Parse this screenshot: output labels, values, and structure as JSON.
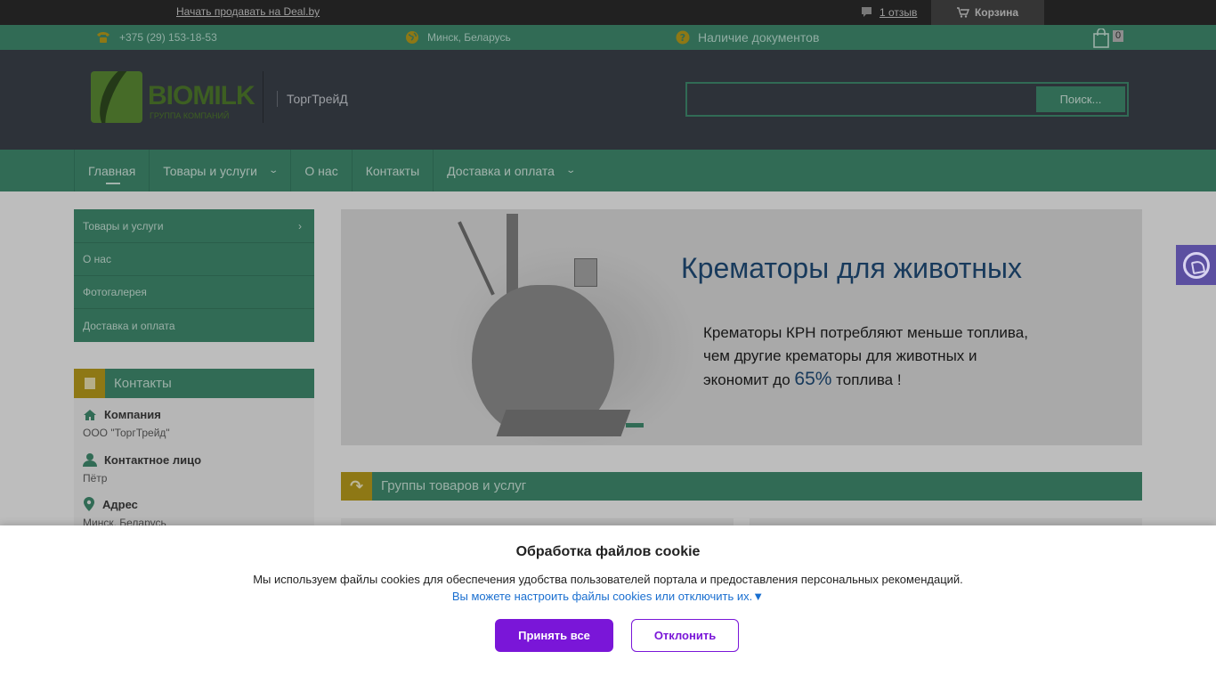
{
  "topbar": {
    "sell_link": "Начать продавать на Deal.by",
    "reviews_link": "1 отзыв",
    "cart_label": "Корзина"
  },
  "infobar": {
    "phone": "+375 (29) 153-18-53",
    "location": "Минск, Беларусь",
    "documents": "Наличие документов",
    "cart_count": "0"
  },
  "header": {
    "logo_text": "BIOMILK",
    "logo_sub": "ГРУППА КОМПАНИЙ",
    "company": "ТоргТрейД",
    "search_placeholder": "",
    "search_button": "Поиск..."
  },
  "nav": {
    "items": [
      {
        "label": "Главная"
      },
      {
        "label": "Товары и услуги"
      },
      {
        "label": "О нас"
      },
      {
        "label": "Контакты"
      },
      {
        "label": "Доставка и оплата"
      }
    ]
  },
  "sidebar": {
    "items": [
      {
        "label": "Товары и услуги"
      },
      {
        "label": "О нас"
      },
      {
        "label": "Фотогалерея"
      },
      {
        "label": "Доставка и оплата"
      }
    ],
    "contacts": {
      "title": "Контакты",
      "company_label": "Компания",
      "company_value": "ООО \"ТоргТрейд\"",
      "person_label": "Контактное лицо",
      "person_value": "Пётр",
      "address_label": "Адрес",
      "address_value": "Минск, Беларусь"
    }
  },
  "slider": {
    "title": "Крематоры для животных",
    "line1": "Крематоры КРН потребляют меньше топлива,",
    "line2": "чем другие крематоры для животных и",
    "line3_pre": "экономит  до ",
    "line3_big": "65%",
    "line3_post": " топлива !"
  },
  "groups": {
    "title": "Группы товаров и услуг"
  },
  "cookie": {
    "title": "Обработка файлов cookie",
    "message": "Мы используем файлы cookies для обеспечения удобства пользователей портала и предоставления персональных рекомендаций.",
    "settings_link": "Вы можете настроить файлы cookies или отключить их.▼",
    "accept": "Принять все",
    "decline": "Отклонить"
  },
  "colors": {
    "green": "#3f8a6e",
    "dark": "#3a4049",
    "accent_purple": "#7a16d8",
    "gold": "#b69a1c"
  }
}
